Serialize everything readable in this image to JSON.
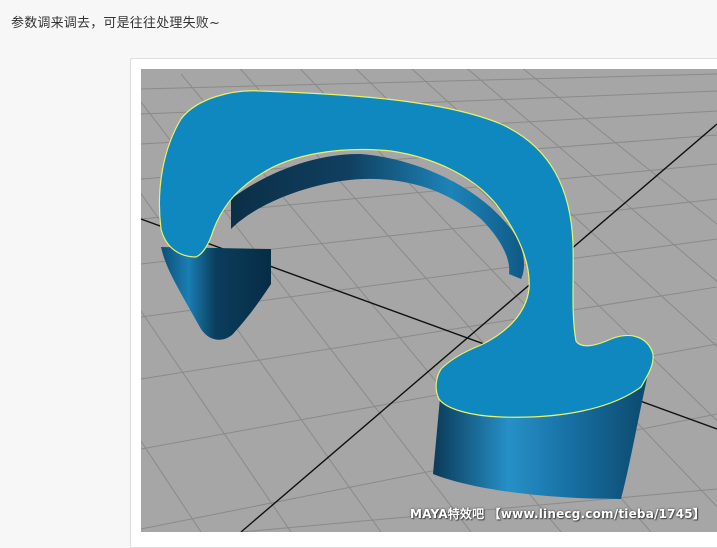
{
  "post": {
    "text": "参数调来调去，可是往往处理失败~"
  },
  "viewport": {
    "background_color": "#a6a6a6",
    "grid_color": "#8a8a8a",
    "axis_color": "#111111",
    "cap_color": "#0f88c0",
    "edge_highlight_color": "#e8f36a",
    "object_icon": "maya-extruded-arrow-model"
  },
  "watermark": {
    "text": "MAYA特效吧 【www.linecg.com/tieba/1745】"
  }
}
